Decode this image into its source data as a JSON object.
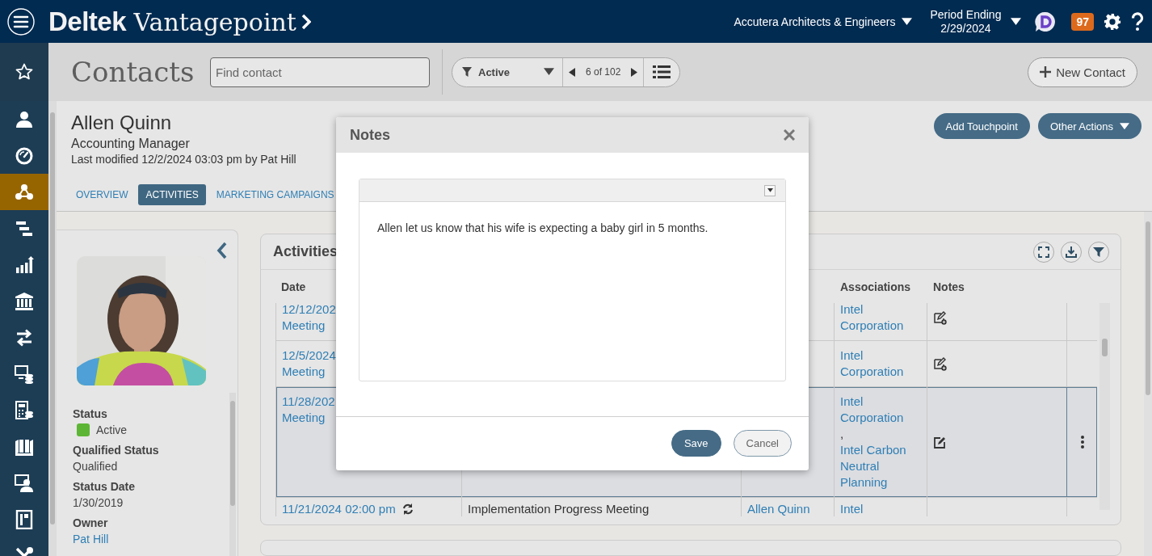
{
  "topbar": {
    "brand": "**Deltek** Vantagepoint",
    "company": "Accutera Architects & Engineers",
    "period_label": "Period Ending",
    "period_date": "2/29/2024",
    "notification_count": "97"
  },
  "nav": {
    "items": [
      {
        "kind": "star",
        "selected": false
      },
      {
        "kind": "person",
        "selected": false
      },
      {
        "kind": "gauge",
        "selected": false
      },
      {
        "kind": "network",
        "selected": true
      },
      {
        "kind": "gantt",
        "selected": false
      },
      {
        "kind": "chart",
        "selected": false
      },
      {
        "kind": "bank",
        "selected": false
      },
      {
        "kind": "transfer",
        "selected": false
      },
      {
        "kind": "screen-coins",
        "selected": false
      },
      {
        "kind": "calculator",
        "selected": false
      },
      {
        "kind": "book",
        "selected": false
      },
      {
        "kind": "presenter",
        "selected": false
      },
      {
        "kind": "frame",
        "selected": false
      },
      {
        "kind": "tools",
        "selected": false
      }
    ]
  },
  "page": {
    "title": "Contacts",
    "search": {
      "placeholder": "Find contact"
    },
    "filter": "Active",
    "record_position": "6 of 102",
    "new_button": "New Contact"
  },
  "contact": {
    "name": "Allen Quinn",
    "job_title": "Accounting Manager",
    "last_modified": "Last modified 12/2/2024 03:03 pm by Pat Hill",
    "tabs": [
      {
        "label": "OVERVIEW",
        "selected": false
      },
      {
        "label": "ACTIVITIES",
        "selected": true
      },
      {
        "label": "MARKETING CAMPAIGNS",
        "selected": false
      }
    ],
    "actions": [
      {
        "label": "Add Touchpoint",
        "kind": "plain"
      },
      {
        "label": "Other Actions",
        "kind": "menu"
      }
    ]
  },
  "profile": {
    "fields": [
      {
        "label": "Status",
        "value": "Active",
        "kind": "status"
      },
      {
        "label": "Qualified Status",
        "value": "Qualified",
        "kind": "text"
      },
      {
        "label": "Status Date",
        "value": "1/30/2019",
        "kind": "text"
      },
      {
        "label": "Owner",
        "value": "Pat Hill",
        "kind": "link"
      }
    ]
  },
  "activities": {
    "title": "Activities",
    "columns": {
      "date": "Date",
      "associations": "Associations",
      "notes": "Notes"
    },
    "rows": [
      {
        "date": "12/12/202",
        "type": "Meeting",
        "associations": [
          {
            "kind": "link",
            "text": "Intel Corporation"
          }
        ],
        "has_note": false,
        "selected": false
      },
      {
        "date": "12/5/2024",
        "type": "Meeting",
        "associations": [
          {
            "kind": "link",
            "text": "Intel Corporation"
          }
        ],
        "has_note": false,
        "selected": false
      },
      {
        "date": "11/28/202",
        "type": "Meeting",
        "associations": [
          {
            "kind": "link",
            "text": "Intel Corporation"
          },
          {
            "kind": "separator",
            "text": ","
          },
          {
            "kind": "link",
            "text": "Intel Carbon Neutral Planning"
          }
        ],
        "has_note": true,
        "selected": true
      },
      {
        "date": "11/21/2024 02:00 pm",
        "recurring": true,
        "column_2": "Implementation Progress Meeting",
        "column_3": "Allen Quinn",
        "associations": [
          {
            "kind": "link",
            "text": "Intel"
          }
        ],
        "selected": false
      }
    ]
  },
  "dialog": {
    "title": "Notes",
    "text": "Allen let us know that his wife is expecting a baby girl in 5 months.",
    "buttons": [
      {
        "label": "Save",
        "kind": "primary"
      },
      {
        "label": "Cancel",
        "kind": "secondary"
      }
    ]
  }
}
